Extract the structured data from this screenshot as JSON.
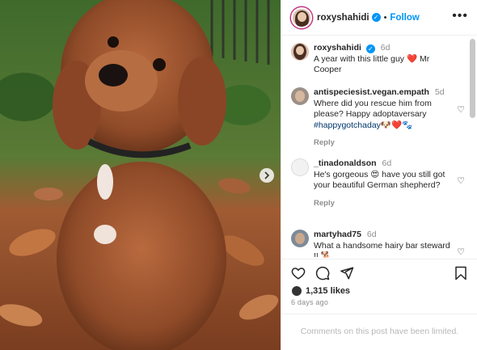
{
  "post_author": {
    "username": "roxyshahidi",
    "follow_label": "Follow",
    "separator": "•"
  },
  "caption": {
    "username": "roxyshahidi",
    "time": "6d",
    "text": "A year with this little guy ❤️ Mr Cooper"
  },
  "comments": [
    {
      "username": "antispeciesist.vegan.empath",
      "time": "5d",
      "text": "Where did you rescue him from please? Happy adoptaversary ",
      "hashtag": "#happygotchaday",
      "emoji": "🐶❤️🐾",
      "reply_label": "Reply"
    },
    {
      "username": "_tinadonaldson",
      "time": "6d",
      "text": "He's gorgeous 😍 have you still got your beautiful German shepherd?",
      "reply_label": "Reply"
    },
    {
      "username": "martyhad75",
      "time": "6d",
      "text": "What a handsome hairy bar steward !! 🐕"
    }
  ],
  "likes": {
    "count_text": "1,315 likes"
  },
  "date_text": "6 days ago",
  "limited_notice": "Comments on this post have been limited.",
  "colors": {
    "link_blue": "#0095f6",
    "hashtag": "#00376b",
    "muted": "#8e8e8e"
  }
}
